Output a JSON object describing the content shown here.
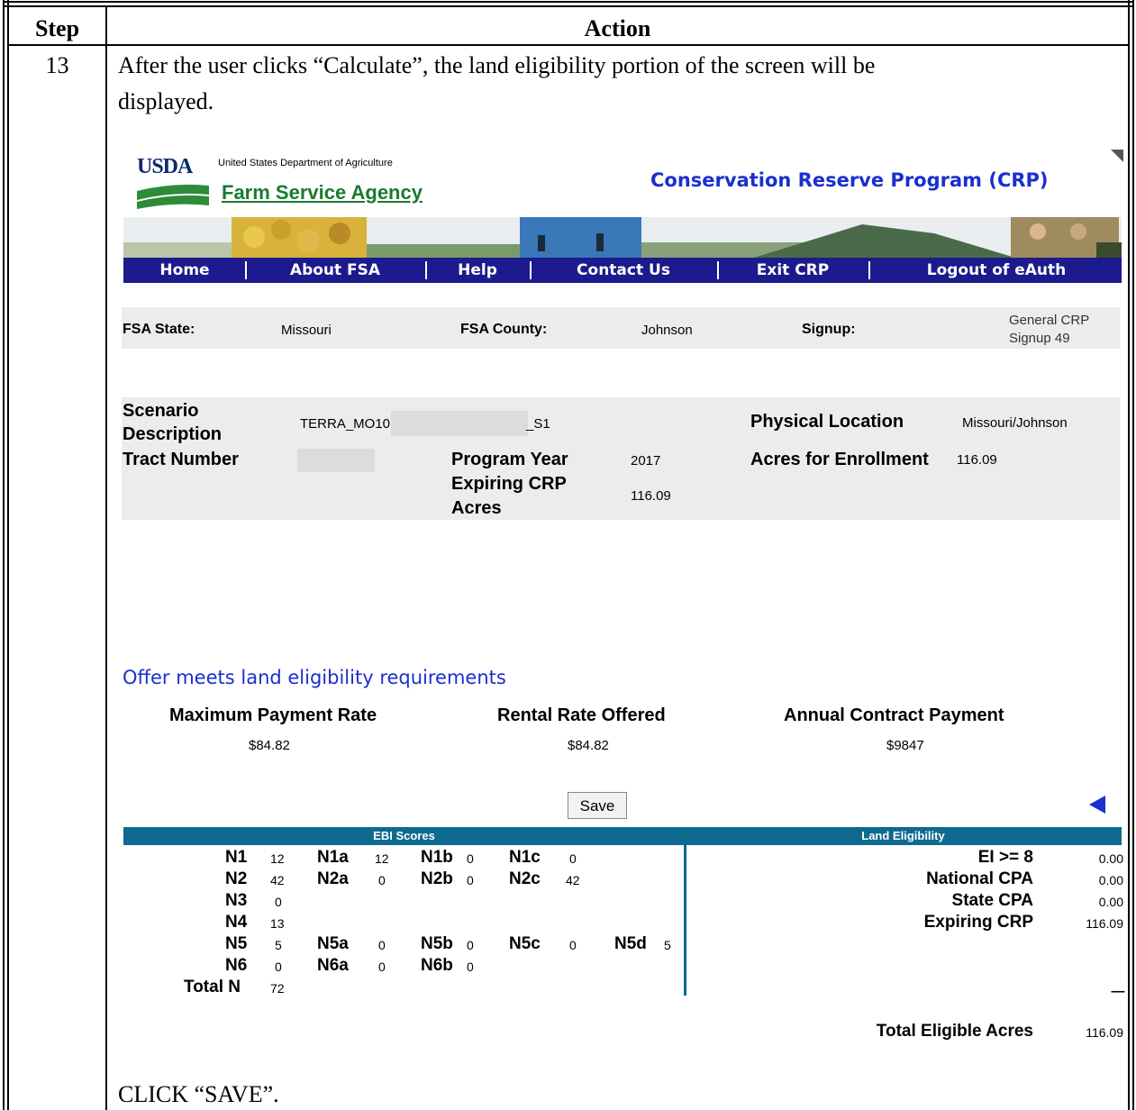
{
  "table": {
    "col_step": "Step",
    "col_action": "Action",
    "step_number": "13",
    "instruction_line1": "After the user clicks “Calculate”, the land eligibility portion of the screen will be",
    "instruction_line2": "displayed.",
    "footer_instruction": "CLICK “SAVE”."
  },
  "screen": {
    "usda_logo": "USDA",
    "usda_dept": "United States Department of Agriculture",
    "agency": "Farm Service Agency",
    "program_title": "Conservation Reserve Program (CRP)",
    "nav": [
      "Home",
      "About FSA",
      "Help",
      "Contact Us",
      "Exit CRP",
      "Logout of eAuth"
    ],
    "location": {
      "state_label": "FSA State:",
      "state_value": "Missouri",
      "county_label": "FSA County:",
      "county_value": "Johnson",
      "signup_label": "Signup:",
      "signup_value_line1": "General CRP",
      "signup_value_line2": "Signup 49"
    },
    "scenario": {
      "desc_label_line1": "Scenario",
      "desc_label_line2": "Description",
      "desc_value_prefix": "TERRA_MO101_",
      "desc_value_suffix": "_S1",
      "phys_label": "Physical Location",
      "phys_value": "Missouri/Johnson",
      "tract_label": "Tract Number",
      "prog_year_label": "Program Year",
      "prog_year_value": "2017",
      "acres_label": "Acres for Enrollment",
      "acres_value": "116.09",
      "exp_label_line1": "Expiring CRP",
      "exp_label_line2": "Acres",
      "exp_value": "116.09"
    },
    "eligibility_message": "Offer meets land eligibility requirements",
    "payments": {
      "max_label": "Maximum Payment Rate",
      "max_value": "$84.82",
      "rental_label": "Rental Rate Offered",
      "rental_value": "$84.82",
      "annual_label": "Annual Contract Payment",
      "annual_value": "$9847"
    },
    "save_button": "Save",
    "ebi_header": "EBI Scores",
    "land_header": "Land Eligibility",
    "ebi": {
      "N1": "12",
      "N1a": "12",
      "N1b": "0",
      "N1c": "0",
      "N2": "42",
      "N2a": "0",
      "N2b": "0",
      "N2c": "42",
      "N3": "0",
      "N4": "13",
      "N5": "5",
      "N5a": "0",
      "N5b": "0",
      "N5c": "0",
      "N5d": "5",
      "N6": "0",
      "N6a": "0",
      "N6b": "0",
      "total_label": "Total N",
      "total": "72"
    },
    "land": {
      "ei_label": "EI >= 8",
      "ei_value": "0.00",
      "ncpa_label": "National CPA",
      "ncpa_value": "0.00",
      "scpa_label": "State CPA",
      "scpa_value": "0.00",
      "exp_label": "Expiring CRP",
      "exp_value": "116.09",
      "dash": "------",
      "total_label": "Total Eligible Acres",
      "total_value": "116.09"
    }
  }
}
